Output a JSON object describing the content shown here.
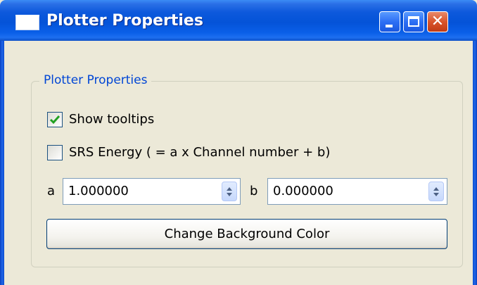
{
  "window": {
    "title": "Plotter Properties",
    "controls": {
      "minimize_icon": "minimize-icon",
      "maximize_icon": "maximize-icon",
      "close_icon": "close-icon",
      "close_glyph": "✕"
    },
    "colors": {
      "titlebar": "#0453d8",
      "close_button": "#d9542b",
      "body": "#ece9d8",
      "group_title": "#0046d5"
    }
  },
  "group": {
    "title": "Plotter Properties"
  },
  "options": {
    "show_tooltips": {
      "label": "Show tooltips",
      "checked": true
    },
    "srs_energy": {
      "label": "SRS Energy ( = a x Channel number + b)",
      "checked": false
    }
  },
  "params": {
    "a": {
      "label": "a",
      "value": "1.000000"
    },
    "b": {
      "label": "b",
      "value": "0.000000"
    }
  },
  "actions": {
    "change_bg_label": "Change Background Color"
  }
}
